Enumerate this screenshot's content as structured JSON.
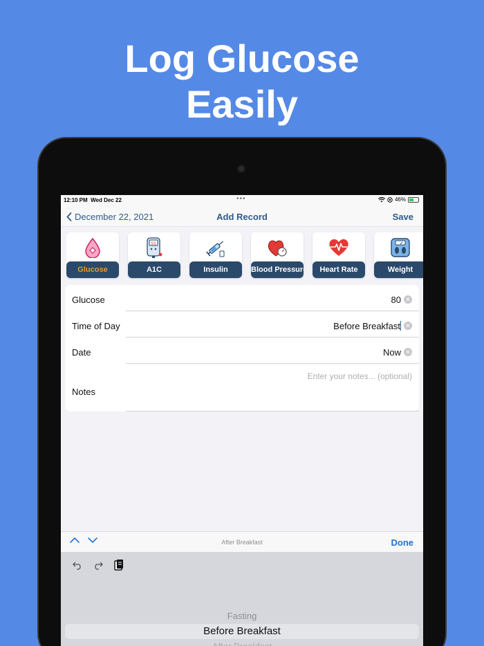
{
  "headline": {
    "line1": "Log Glucose",
    "line2": "Easily"
  },
  "status_bar": {
    "time": "12:10 PM",
    "date": "Wed Dec 22",
    "battery_percent": "46%",
    "battery_level": 0.46
  },
  "nav": {
    "back_label": "December 22, 2021",
    "title": "Add Record",
    "save_label": "Save"
  },
  "categories": [
    {
      "label": "Glucose",
      "icon": "glucose-drop-icon",
      "selected": true
    },
    {
      "label": "A1C",
      "icon": "glucometer-icon",
      "selected": false
    },
    {
      "label": "Insulin",
      "icon": "syringe-icon",
      "selected": false
    },
    {
      "label": "Blood Pressure",
      "icon": "blood-pressure-heart-icon",
      "selected": false
    },
    {
      "label": "Heart Rate",
      "icon": "heart-rate-icon",
      "selected": false
    },
    {
      "label": "Weight",
      "icon": "scale-icon",
      "selected": false
    }
  ],
  "form": {
    "glucose": {
      "label": "Glucose",
      "value": "80"
    },
    "time_of_day": {
      "label": "Time of Day",
      "value": "Before Breakfast"
    },
    "date": {
      "label": "Date",
      "value": "Now"
    },
    "notes": {
      "label": "Notes",
      "placeholder": "Enter your notes... (optional)"
    }
  },
  "accessory": {
    "center_label": "After Breakfast",
    "done_label": "Done"
  },
  "picker": {
    "options": [
      "Fasting",
      "Before Breakfast",
      "After Breakfast"
    ],
    "selected": "Before Breakfast"
  },
  "colors": {
    "background": "#5589e6",
    "nav_accent": "#2f5a8c",
    "category_label_bg": "#2b4a6b",
    "selected_label": "#f0962a",
    "done": "#1f72d0"
  }
}
